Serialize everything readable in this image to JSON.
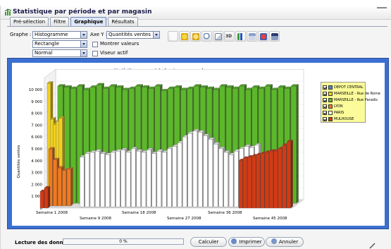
{
  "window": {
    "title": "Statistique par période et par magasin"
  },
  "tabs": [
    {
      "label": "Pré-sélection",
      "active": false
    },
    {
      "label": "Filtre",
      "active": false
    },
    {
      "label": "Graphique",
      "active": true
    },
    {
      "label": "Résultats",
      "active": false
    }
  ],
  "controls": {
    "graphe_label": "Graphe :",
    "graphe_value": "Histogramme",
    "shape_value": "Rectangle",
    "style_value": "Normal",
    "axe_y_label": "Axe Y :",
    "axe_y_value": "Quantités ventes",
    "montrer_valeurs_label": "Montrer valeurs",
    "viseur_actif_label": "Viseur actif",
    "toolbar_3d_label": "3D"
  },
  "colors": {
    "chart_border": "#3b70d2",
    "legend_bg": "#fbfb9a",
    "series": {
      "DEPOT CENTRAL": "#4f86d9",
      "MARSEILLE - Rue de Rome": "#f0d020",
      "MARSEILLE - Rue Paradis": "#5cb82a",
      "LYON": "#f07a20",
      "PARIS": "#ffffff",
      "MULHOUSE": "#d43a14"
    }
  },
  "chart_data": {
    "type": "bar",
    "title": "Statistique par période et par magasin",
    "ylabel": "Quantités ventes",
    "ylim": [
      0,
      11000
    ],
    "yticks": [
      "0",
      "1 000",
      "2 000",
      "3 000",
      "4 000",
      "5 000",
      "6 000",
      "7 000",
      "8 000",
      "9 000",
      "10 000"
    ],
    "xticks": [
      "Semaine 1 2008",
      "Semaine 9 2008",
      "Semaine 18 2008",
      "Semaine 27 2008",
      "Semaine 36 2008",
      "Semaine 45 2008"
    ],
    "legend_position": "top-right",
    "series": [
      {
        "name": "DEPOT CENTRAL",
        "values": []
      },
      {
        "name": "MARSEILLE - Rue de Rome",
        "values": [
          10000,
          7000,
          6600,
          6900,
          7200
        ]
      },
      {
        "name": "MARSEILLE - Rue Paradis",
        "values": [
          9900,
          9800,
          9700,
          9900,
          9600,
          9800,
          10000,
          9700,
          9900,
          9800,
          9600,
          9700,
          9900,
          9800,
          9700,
          9900,
          9500,
          9700,
          9800,
          9600,
          9700,
          9900,
          9800,
          9700,
          9600,
          9900,
          9800,
          9700,
          9900,
          9600,
          9800,
          9700,
          9900,
          9600,
          9800,
          9700,
          9900
        ]
      },
      {
        "name": "LYON",
        "values": [
          4800,
          3900,
          3200,
          3000,
          3100
        ]
      },
      {
        "name": "PARIS",
        "values": [
          4200,
          4500,
          4600,
          4700,
          4500,
          4400,
          4600,
          4700,
          4800,
          4600,
          4900,
          4700,
          4600,
          4800,
          4500,
          4700,
          4600,
          4900,
          5100,
          5400,
          5900,
          6200,
          6400,
          6300,
          6000,
          5700,
          5300,
          4900,
          4600,
          4400,
          4700,
          4900,
          5100,
          5000,
          5200
        ]
      },
      {
        "name": "MULHOUSE",
        "values": [
          1400,
          1700,
          4000,
          4200,
          4300,
          4400,
          4500,
          4600,
          4700,
          4800,
          4800,
          5000,
          5300,
          5600
        ]
      }
    ]
  },
  "status": {
    "label": "Lecture des données ...",
    "progress_text": "0 %",
    "progress_value": 0
  },
  "buttons": {
    "calculer": "Calculer",
    "imprimer": "Imprimer",
    "annuler": "Annuler"
  }
}
